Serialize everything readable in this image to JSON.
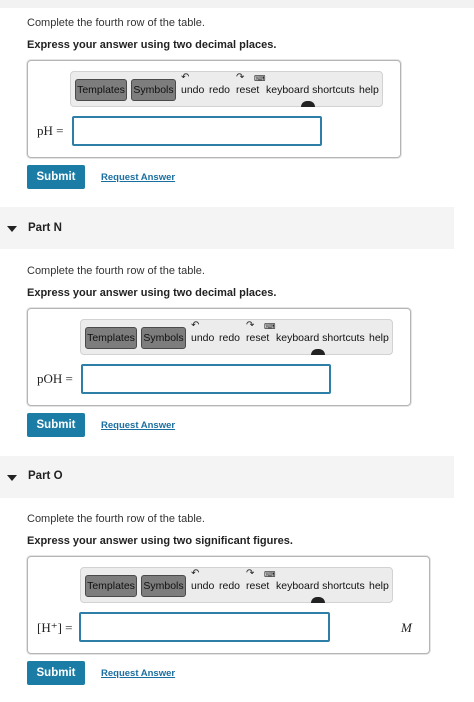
{
  "part_m": {
    "instruction": "Complete the fourth row of the table.",
    "precision_note": "Express your answer using two decimal places.",
    "toolbar": {
      "templates": "Templates",
      "symbols": "Symbols",
      "undo": "undo",
      "redo": "redo",
      "reset": "reset",
      "shortcuts": "keyboard shortcuts",
      "help": "help"
    },
    "answer_label": "pH =",
    "answer_value": "",
    "unit": "",
    "submit": "Submit",
    "request": "Request Answer"
  },
  "part_n": {
    "title": "Part N",
    "instruction": "Complete the fourth row of the table.",
    "precision_note": "Express your answer using two decimal places.",
    "toolbar": {
      "templates": "Templates",
      "symbols": "Symbols",
      "undo": "undo",
      "redo": "redo",
      "reset": "reset",
      "shortcuts": "keyboard shortcuts",
      "help": "help"
    },
    "answer_label": "pOH =",
    "answer_value": "",
    "unit": "",
    "submit": "Submit",
    "request": "Request Answer"
  },
  "part_o": {
    "title": "Part O",
    "instruction": "Complete the fourth row of the table.",
    "precision_note": "Express your answer using two significant figures.",
    "toolbar": {
      "templates": "Templates",
      "symbols": "Symbols",
      "undo": "undo",
      "redo": "redo",
      "reset": "reset",
      "shortcuts": "keyboard shortcuts",
      "help": "help"
    },
    "answer_label": "[H⁺] =",
    "answer_value": "",
    "unit": "M",
    "submit": "Submit",
    "request": "Request Answer"
  },
  "icons": [
    "undo-arrow-icon",
    "redo-arrow-icon",
    "keyboard-icon",
    "collapse-triangle-icon"
  ],
  "colors": {
    "accent": "#1b7da6",
    "input_border": "#2d7fa8",
    "link": "#1b6fa0"
  }
}
